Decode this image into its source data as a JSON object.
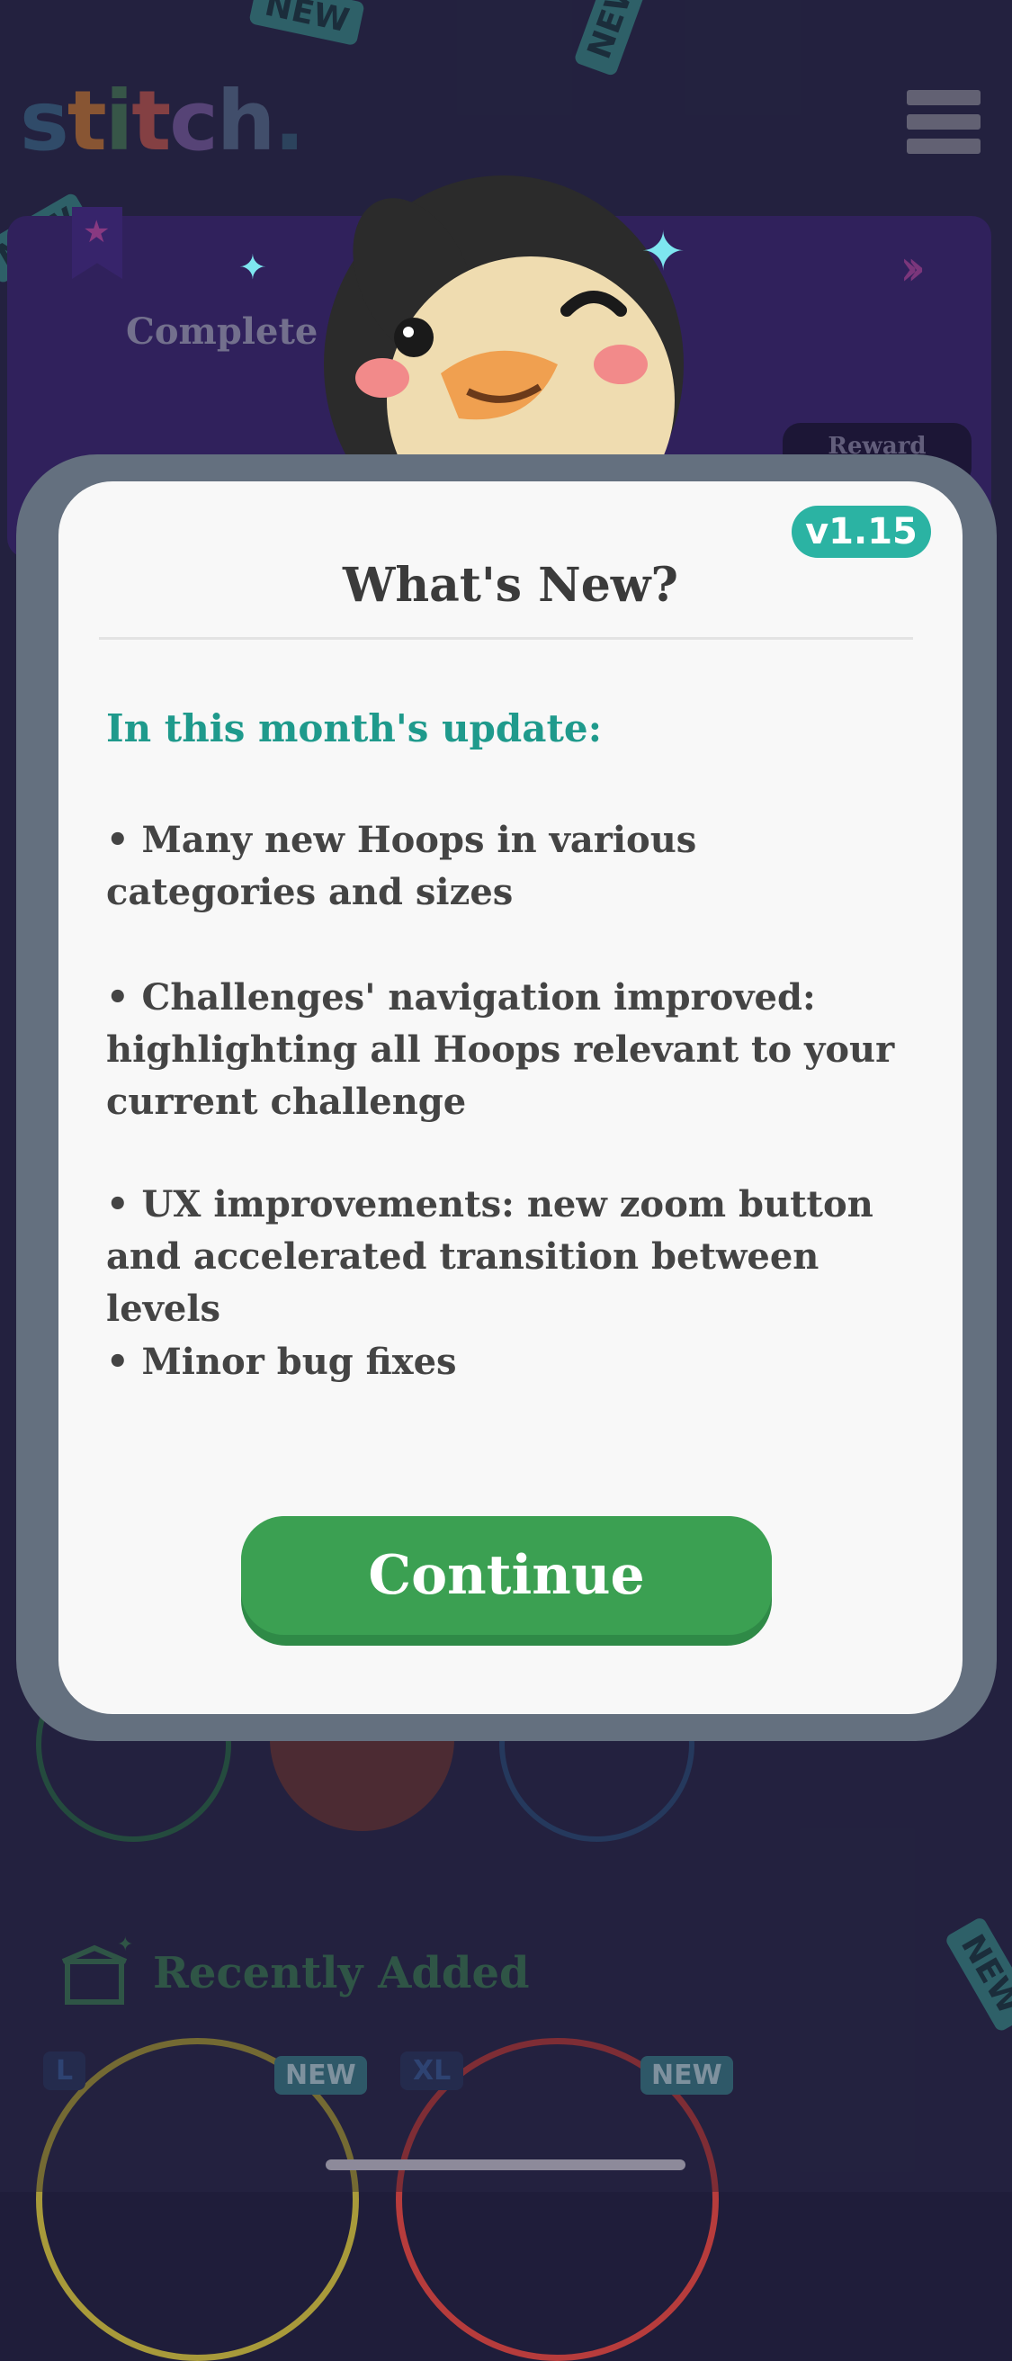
{
  "app": {
    "logo_text": "stitch."
  },
  "challenge": {
    "text": "Complete o                 Hoops for",
    "reward_label": "Reward"
  },
  "modal": {
    "version": "v1.15",
    "title": "What's New?",
    "heading": "In this month's update:",
    "items": [
      "• Many new Hoops in various categories and sizes",
      "• Challenges' navigation improved: highlighting all Hoops relevant to your current challenge",
      "• UX improvements: new zoom button and accelerated transition between levels",
      "• Minor bug fixes"
    ],
    "continue_label": "Continue"
  },
  "recently_added": {
    "title": "Recently Added",
    "cards": [
      {
        "size": "L",
        "badge": "NEW"
      },
      {
        "size": "XL",
        "badge": "NEW"
      }
    ]
  },
  "decor": {
    "new_tag": "NEW"
  },
  "colors": {
    "accent_teal": "#2bb3a3",
    "continue_green": "#3ba052",
    "heading_teal": "#1f9a8c"
  }
}
